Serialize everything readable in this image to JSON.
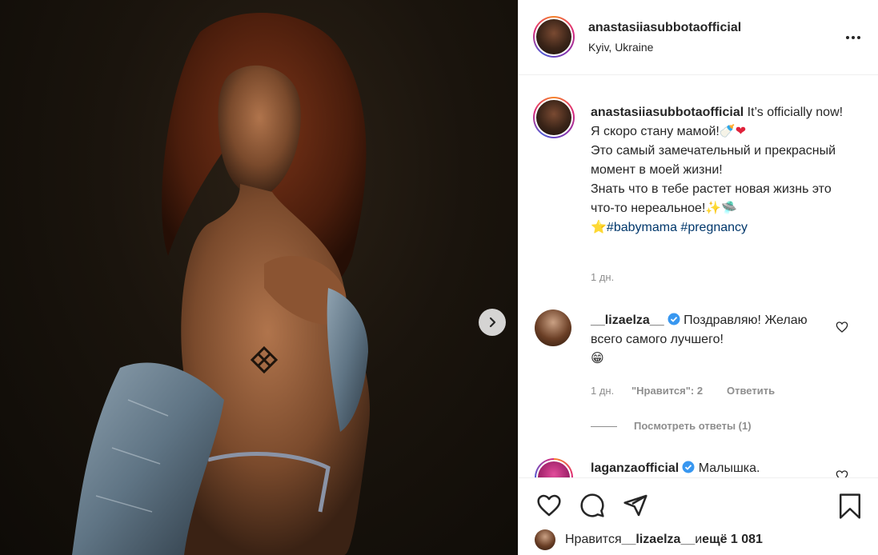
{
  "post": {
    "author": "anastasiiasubbota​official",
    "location": "Kyiv, Ukraine"
  },
  "caption": {
    "username": "anastasiiasubbotaofficial",
    "line1": " It’s officially now!",
    "line2": "Я скоро стану мамой!",
    "line3": "Это самый замечательный и прекрасный момент в моей жизни!",
    "line4": "Знать что в тебе растет новая жизнь это что-то нереальное!",
    "hashtag1": "#babymama",
    "hashtag2": "#pregnancy",
    "time": "1 дн."
  },
  "comments": [
    {
      "username": "__lizaelza__",
      "text": "Поздравляю! Желаю всего самого лучшего!",
      "time": "1 дн.",
      "likes": "\"Нравится\": 2",
      "reply": "Ответить",
      "view_replies": "Посмотреть ответы (1)"
    },
    {
      "username": "laganzaofficial",
      "text": "Малышка."
    }
  ],
  "likes_bar": {
    "prefix": "Нравится ",
    "user": "__lizaelza__",
    "middle": " и ",
    "count": "ещё 1 081"
  },
  "icons": [
    "more-icon",
    "heart-icon",
    "comment-icon",
    "share-icon",
    "bookmark-icon",
    "next-arrow-icon",
    "verified-icon"
  ]
}
